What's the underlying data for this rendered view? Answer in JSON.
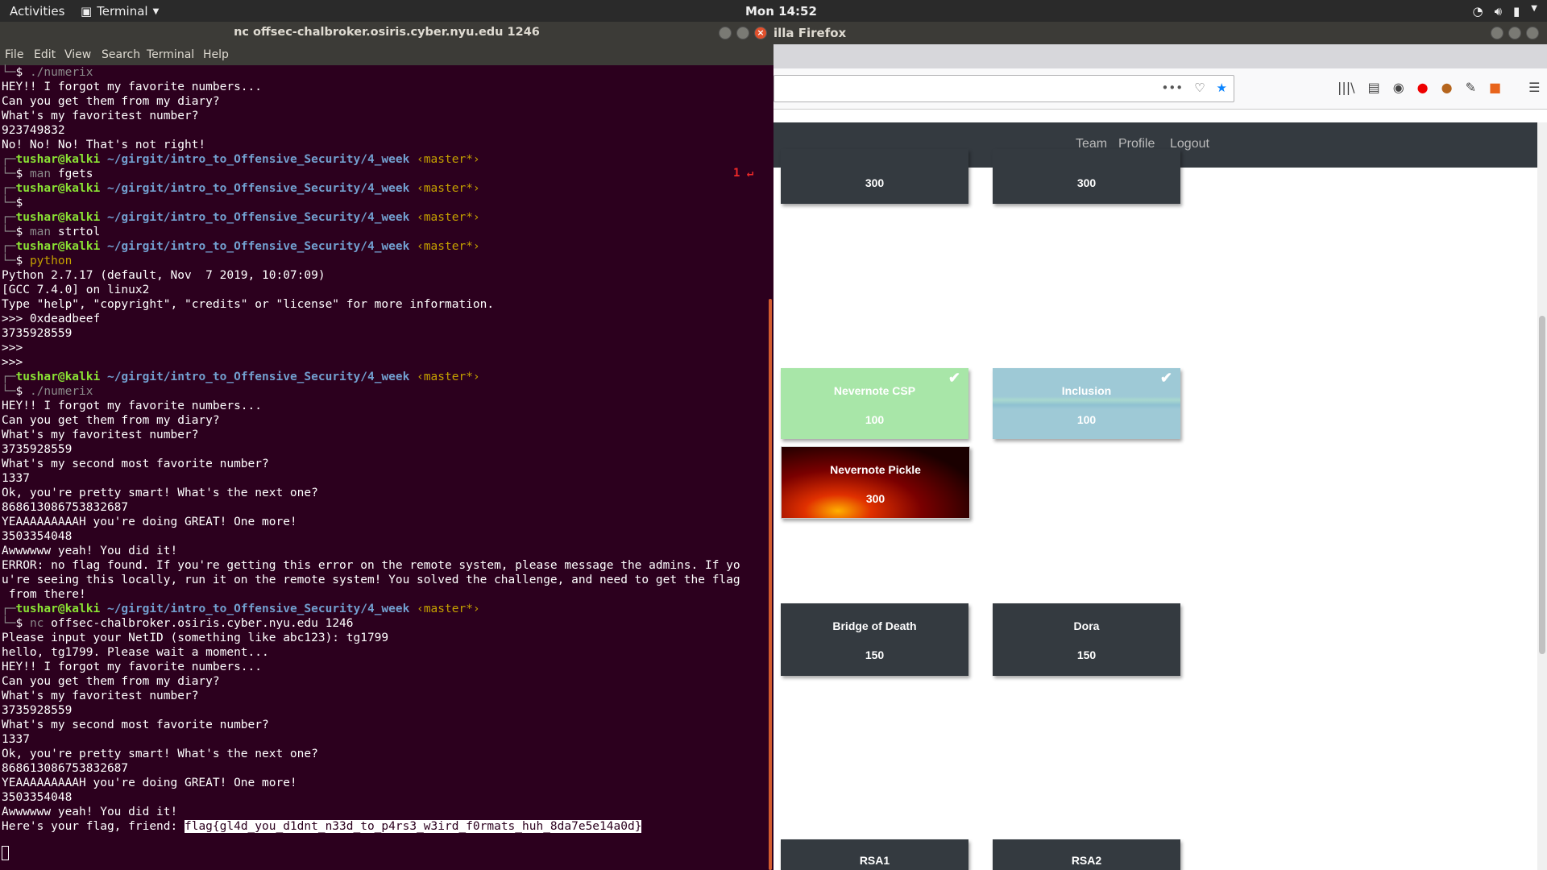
{
  "topbar": {
    "activities": "Activities",
    "app": "Terminal",
    "clock": "Mon 14:52"
  },
  "firefox": {
    "title_fragment": "illa Firefox",
    "nav": [
      "Team",
      "Profile",
      "Logout"
    ],
    "cards": [
      {
        "name": "",
        "points": "300",
        "color": "#343a40"
      },
      {
        "name": "",
        "points": "300",
        "color": "#343a40"
      },
      {
        "name": "Nevernote CSP",
        "points": "100",
        "color": "#a8e6a8",
        "solved": true
      },
      {
        "name": "Inclusion",
        "points": "100",
        "color": "#9ec9d6",
        "solved": true
      },
      {
        "name": "Nevernote Pickle",
        "points": "300",
        "color": "#8b0000"
      },
      {
        "name": "Bridge of Death",
        "points": "150",
        "color": "#343a40"
      },
      {
        "name": "Dora",
        "points": "150",
        "color": "#343a40"
      },
      {
        "name": "RSA1",
        "points": "",
        "color": "#343a40"
      },
      {
        "name": "RSA2",
        "points": "",
        "color": "#343a40"
      }
    ]
  },
  "terminal": {
    "title": "nc offsec-chalbroker.osiris.cyber.nyu.edu 1246",
    "menu": [
      "File",
      "Edit",
      "View",
      "Search",
      "Terminal",
      "Help"
    ],
    "user": "tushar@kalki",
    "path": "~/girgit/intro_to_Offensive_Security/4_week",
    "branch": "‹master*›",
    "exit_code": "1 ↵",
    "cmd_numerix": "./numerix",
    "cmd_man_fgets": "man fgets",
    "cmd_man_strtol": "man strtol",
    "cmd_python": "python",
    "cmd_nc": "nc offsec-chalbroker.osiris.cyber.nyu.edu 1246",
    "out1": [
      "HEY!! I forgot my favorite numbers...",
      "Can you get them from my diary?",
      "What's my favoritest number?",
      "923749832",
      "No! No! No! That's not right!"
    ],
    "py": [
      "Python 2.7.17 (default, Nov  7 2019, 10:07:09)",
      "[GCC 7.4.0] on linux2",
      "Type \"help\", \"copyright\", \"credits\" or \"license\" for more information.",
      ">>> 0xdeadbeef",
      "3735928559",
      ">>>",
      ">>>"
    ],
    "out2": [
      "HEY!! I forgot my favorite numbers...",
      "Can you get them from my diary?",
      "What's my favoritest number?",
      "3735928559",
      "What's my second most favorite number?",
      "1337",
      "Ok, you're pretty smart! What's the next one?",
      "868613086753832687",
      "YEAAAAAAAAAH you're doing GREAT! One more!",
      "3503354048",
      "Awwwwww yeah! You did it!",
      "ERROR: no flag found. If you're getting this error on the remote system, please message the admins. If yo",
      "u're seeing this locally, run it on the remote system! You solved the challenge, and need to get the flag",
      " from there!"
    ],
    "out3": [
      "Please input your NetID (something like abc123): tg1799",
      "hello, tg1799. Please wait a moment...",
      "HEY!! I forgot my favorite numbers...",
      "Can you get them from my diary?",
      "What's my favoritest number?",
      "3735928559",
      "What's my second most favorite number?",
      "1337",
      "Ok, you're pretty smart! What's the next one?",
      "868613086753832687",
      "YEAAAAAAAAAH you're doing GREAT! One more!",
      "3503354048",
      "Awwwwww yeah! You did it!"
    ],
    "flag_prefix": "Here's your flag, friend: ",
    "flag": "flag{gl4d_you_d1dnt_n33d_to_p4rs3_w3ird_f0rmats_huh_8da7e5e14a0d}"
  }
}
